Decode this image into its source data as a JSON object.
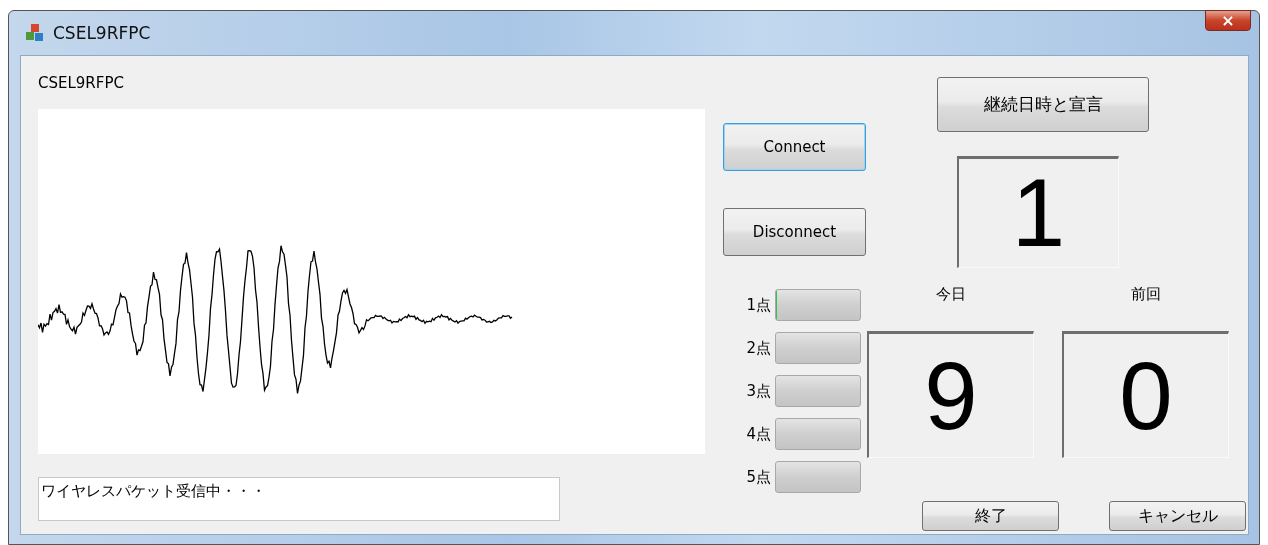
{
  "window": {
    "title": "CSEL9RFPC",
    "close": "×"
  },
  "device_label": "CSEL9RFPC",
  "status_field": {
    "value": "ワイヤレスパケット受信中・・・"
  },
  "connection_buttons": [
    {
      "label": "Connect",
      "focused": true
    },
    {
      "label": "Disconnect",
      "focused": false
    }
  ],
  "level_meters": [
    {
      "label": "1点",
      "level": 0.01
    },
    {
      "label": "2点",
      "level": 0
    },
    {
      "label": "3点",
      "level": 0
    },
    {
      "label": "4点",
      "level": 0
    },
    {
      "label": "5点",
      "level": 0
    }
  ],
  "declare_button": {
    "label": "継続日時と宣言"
  },
  "count_display": {
    "value": "1"
  },
  "counters": [
    {
      "label": "今日",
      "value": "9"
    },
    {
      "label": "前回",
      "value": "0"
    }
  ],
  "footer_buttons": [
    {
      "label": "終了"
    },
    {
      "label": "キャンセル"
    }
  ]
}
